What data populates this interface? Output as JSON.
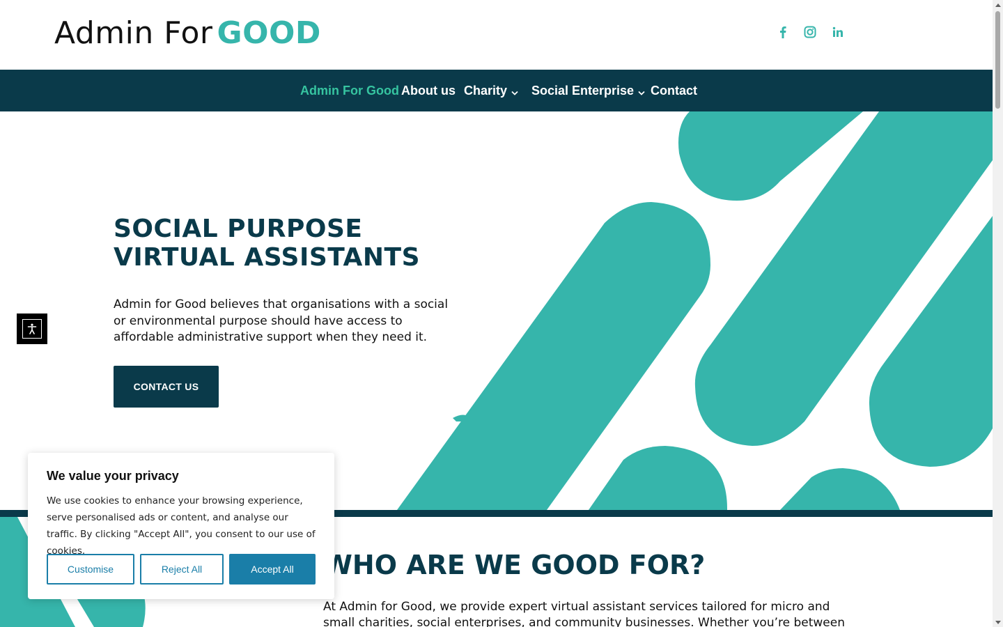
{
  "header": {
    "logo_part1": "Admin For",
    "logo_part2": "GOOD",
    "social_icons": [
      "facebook-icon",
      "instagram-icon",
      "linkedin-icon"
    ]
  },
  "nav": {
    "items": [
      {
        "label": "Admin For Good",
        "active": true
      },
      {
        "label": "About us"
      },
      {
        "label": "Charity",
        "dropdown": true
      },
      {
        "label": "Social Enterprise",
        "dropdown": true
      },
      {
        "label": "Contact"
      }
    ]
  },
  "hero": {
    "title_line1": "SOCIAL PURPOSE",
    "title_line2": "VIRTUAL ASSISTANTS",
    "text": "Admin for Good believes that organisations with a social or environmental purpose should have access to affordable administrative support when they need it.",
    "cta_label": "CONTACT US"
  },
  "section2": {
    "title": "WHO ARE WE GOOD FOR?",
    "text": "At Admin for Good, we provide expert virtual assistant services tailored for micro and small charities, social enterprises, and community businesses. Whether you’re between employees,"
  },
  "accessibility": {
    "icon": "accessibility-icon"
  },
  "cookie_banner": {
    "title": "We value your privacy",
    "text": "We use cookies to enhance your browsing experience, serve personalised ads or content, and analyse our traffic. By clicking \"Accept All\", you consent to our use of cookies.",
    "customise_label": "Customise",
    "reject_label": "Reject All",
    "accept_label": "Accept All"
  },
  "colors": {
    "teal": "#36b5ab",
    "navy": "#0a3a4a",
    "nav_active": "#36c4a0",
    "cookie_blue": "#1a7ea8"
  }
}
